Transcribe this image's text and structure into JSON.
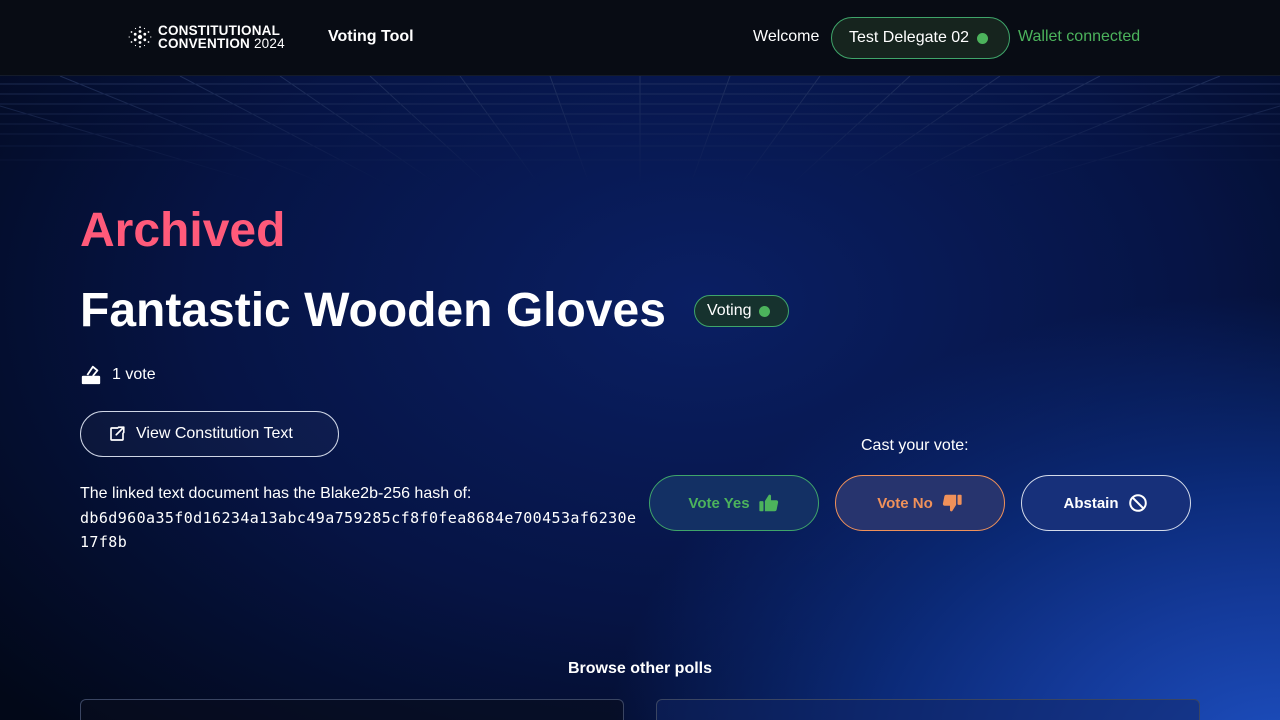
{
  "header": {
    "logo_line1": "CONSTITUTIONAL",
    "logo_line2": "CONVENTION",
    "logo_year": "2024",
    "nav_title": "Voting Tool",
    "welcome": "Welcome",
    "user_name": "Test Delegate 02",
    "wallet_status": "Wallet connected"
  },
  "poll": {
    "status": "Archived",
    "title": "Fantastic Wooden Gloves",
    "badge": "Voting",
    "votes": "1 vote",
    "view_button": "View Constitution Text",
    "hash_label": "The linked text document has the Blake2b-256 hash of:",
    "hash_value": "db6d960a35f0d16234a13abc49a759285cf8f0fea8684e700453af6230e17f8b"
  },
  "vote": {
    "cast_label": "Cast your vote:",
    "yes_label": "Vote Yes",
    "no_label": "Vote No",
    "abstain_label": "Abstain"
  },
  "browse": {
    "label": "Browse other polls"
  },
  "icons": {
    "logo": "cardano-logo-icon",
    "status_dot": "green-dot-icon",
    "votes": "ballot-box-icon",
    "view": "external-link-icon",
    "yes": "thumbs-up-icon",
    "no": "thumbs-down-icon",
    "abstain": "prohibited-icon"
  },
  "colors": {
    "archived": "#ff5a7a",
    "green": "#4cb35c",
    "orange": "#f0915a"
  }
}
